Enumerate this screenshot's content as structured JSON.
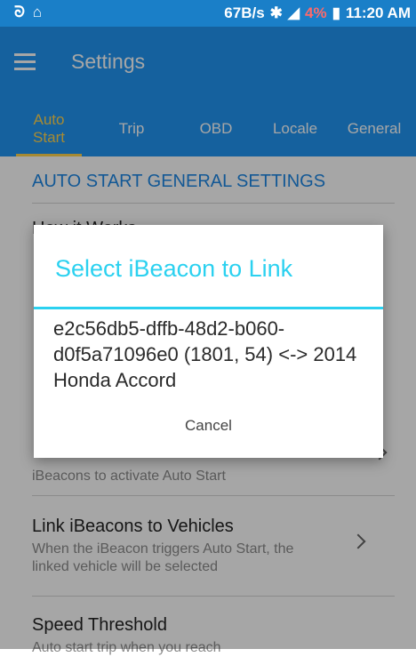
{
  "status_bar": {
    "left_icons": "ᘐ ⌂",
    "net_speed": "67B/s",
    "battery": "4%",
    "time": "11:20 AM"
  },
  "app_bar": {
    "title": "Settings"
  },
  "tabs": [
    {
      "label": "Auto\nStart",
      "active": true
    },
    {
      "label": "Trip"
    },
    {
      "label": "OBD"
    },
    {
      "label": "Locale"
    },
    {
      "label": "General"
    }
  ],
  "section_title": "AUTO START GENERAL SETTINGS",
  "settings": [
    {
      "title": "How it Works",
      "subtitle": "iBeacons to activate Auto Start"
    },
    {
      "title": "Link iBeacons to Vehicles",
      "subtitle": "When the iBeacon triggers Auto Start, the linked vehicle will be selected"
    },
    {
      "title": "Speed Threshold",
      "subtitle": "Auto start trip when you reach"
    }
  ],
  "dialog": {
    "title": "Select iBeacon to Link",
    "item": "e2c56db5-dffb-48d2-b060-d0f5a71096e0 (1801, 54) <-> 2014 Honda Accord",
    "cancel_label": "Cancel"
  },
  "colors": {
    "statusbar": "#1a7fc8",
    "primary": "#2196f3",
    "accent": "#ffd54f",
    "dialog_accent": "#2bd1f0"
  }
}
